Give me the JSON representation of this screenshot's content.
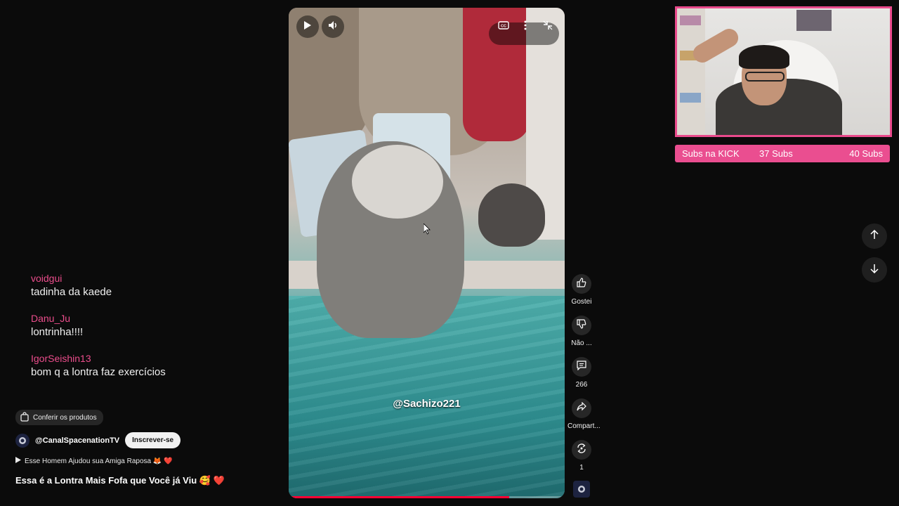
{
  "video": {
    "handle": "@Sachizo221",
    "progress_fraction": 0.8
  },
  "actions": {
    "like_label": "Gostei",
    "dislike_label": "Não ...",
    "comments_count": "266",
    "share_label": "Compart...",
    "remix_count": "1"
  },
  "chat": [
    {
      "user": "voidgui",
      "text": "tadinha da kaede"
    },
    {
      "user": "Danu_Ju",
      "text": "lontrinha!!!!"
    },
    {
      "user": "IgorSeishin13",
      "text": "bom q a lontra faz exercícios"
    }
  ],
  "meta": {
    "products_label": "Conferir os produtos",
    "channel_name": "@CanalSpacenationTV",
    "subscribe_label": "Inscrever-se",
    "related_title": "Esse Homem Ajudou sua Amiga Raposa 🦊 ❤️",
    "video_title": "Essa é a Lontra Mais Fofa que Você já Viu 🥰 ❤️"
  },
  "subs_goal": {
    "label": "Subs na KICK",
    "current": "37 Subs",
    "goal": "40 Subs"
  },
  "colors": {
    "accent_pink": "#ea4e90",
    "chat_user": "#ec4d8c",
    "progress_red": "#ff0033"
  }
}
